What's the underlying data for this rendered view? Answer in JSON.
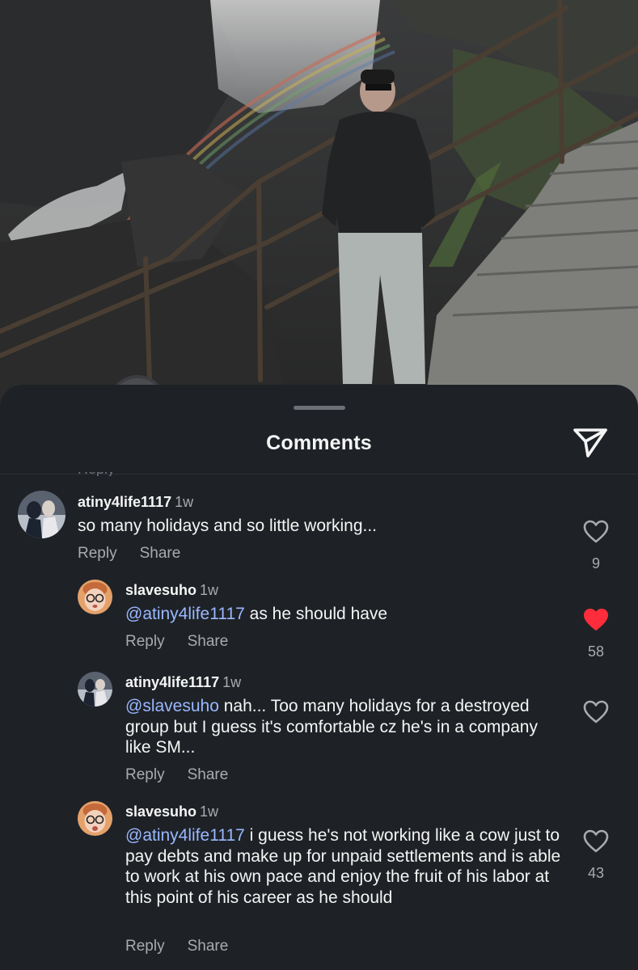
{
  "sheet": {
    "title": "Comments"
  },
  "comments": [
    {
      "username": "atiny4life1117",
      "time": "1w",
      "mention": "",
      "text": "so many holidays and so little working...",
      "reply_label": "Reply",
      "share_label": "Share",
      "likes": "9",
      "liked": false
    },
    {
      "username": "slavesuho",
      "time": "1w",
      "mention": "@atiny4life1117",
      "text": " as he should have",
      "reply_label": "Reply",
      "share_label": "Share",
      "likes": "58",
      "liked": true
    },
    {
      "username": "atiny4life1117",
      "time": "1w",
      "mention": "@slavesuho",
      "text": " nah... Too many holidays for a destroyed group but I guess it's comfortable cz he's in a company like SM...",
      "reply_label": "Reply",
      "share_label": "Share",
      "likes": "",
      "liked": false
    },
    {
      "username": "slavesuho",
      "time": "1w",
      "mention": "@atiny4life1117",
      "text": " i guess he's not working like a cow just to pay debts and make up for unpaid settlements and is able to work at his own pace and enjoy the fruit of his labor at this point of his career as he should",
      "reply_label": "Reply",
      "share_label": "Share",
      "likes": "43",
      "liked": false
    }
  ],
  "colors": {
    "sheet_bg": "#1e2226",
    "mention": "#9ab7ff",
    "like_active": "#ff2d3c",
    "secondary_text": "#a8aaae"
  },
  "icons": {
    "send": "paper-plane-icon",
    "like": "heart-icon"
  }
}
